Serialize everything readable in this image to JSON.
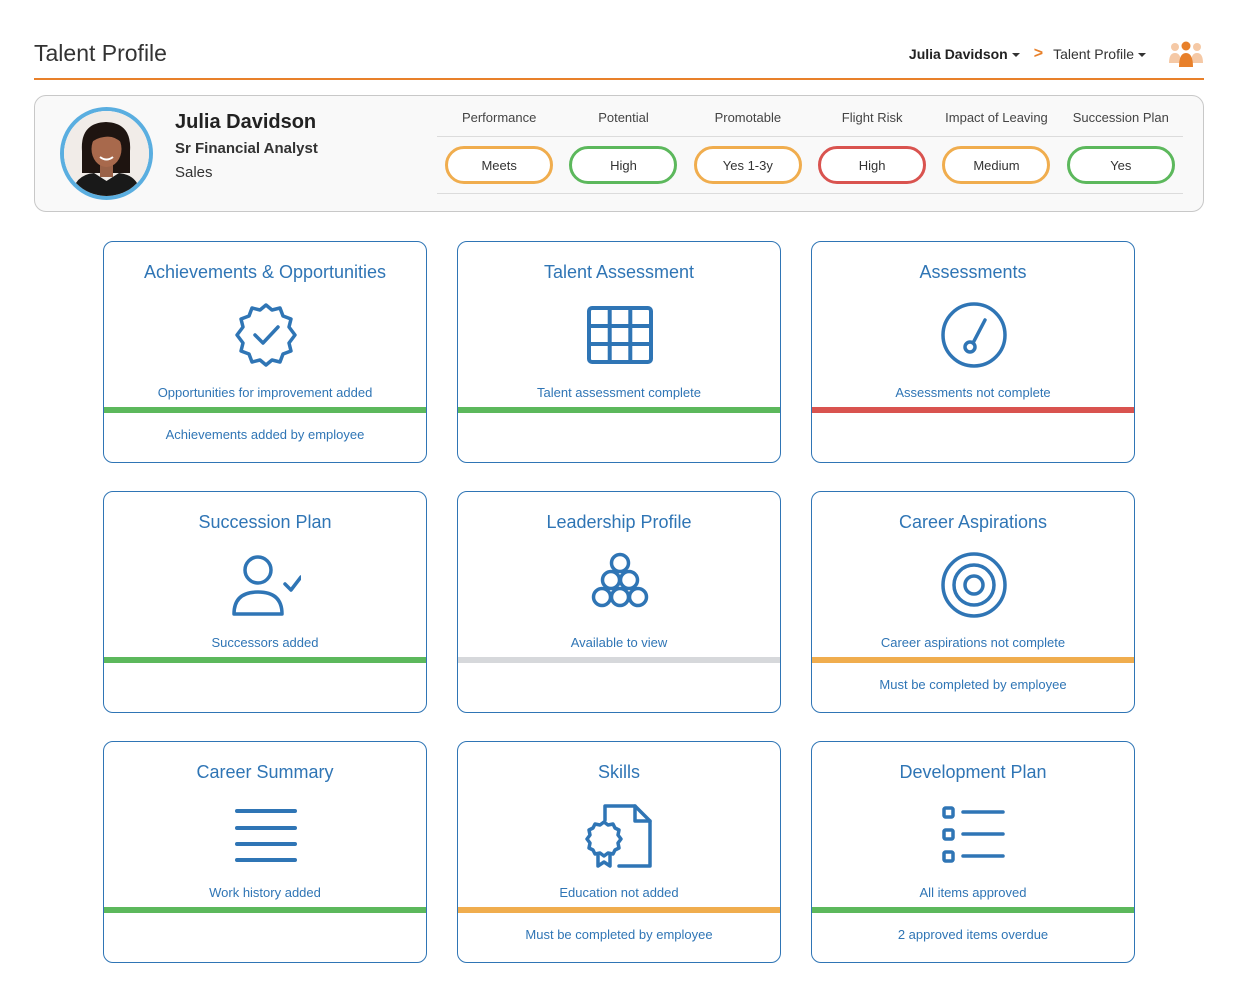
{
  "header": {
    "title": "Talent Profile",
    "user_menu": "Julia Davidson",
    "chevron": ">",
    "page_menu": "Talent Profile",
    "icon": "people-group-icon"
  },
  "profile": {
    "name": "Julia Davidson",
    "job_title": "Sr Financial Analyst",
    "department": "Sales",
    "metrics": [
      {
        "label": "Performance",
        "value": "Meets",
        "color": "#f0ad4e"
      },
      {
        "label": "Potential",
        "value": "High",
        "color": "#5cb85c"
      },
      {
        "label": "Promotable",
        "value": "Yes 1-3y",
        "color": "#f0ad4e"
      },
      {
        "label": "Flight Risk",
        "value": "High",
        "color": "#d9534f"
      },
      {
        "label": "Impact of Leaving",
        "value": "Medium",
        "color": "#f0ad4e"
      },
      {
        "label": "Succession Plan",
        "value": "Yes",
        "color": "#5cb85c"
      }
    ]
  },
  "colors": {
    "accent": "#e8802a",
    "card_blue": "#2f75b5",
    "green": "#5cb85c",
    "red": "#d9534f",
    "orange": "#f0ad4e",
    "gray": "#d6d8db"
  },
  "cards": [
    {
      "title": "Achievements & Opportunities",
      "icon": "badge-check-icon",
      "status": "Opportunities for improvement added",
      "bar_color": "#5cb85c",
      "note": "Achievements added by employee"
    },
    {
      "title": "Talent Assessment",
      "icon": "grid-icon",
      "status": "Talent assessment complete",
      "bar_color": "#5cb85c",
      "note": ""
    },
    {
      "title": "Assessments",
      "icon": "gauge-icon",
      "status": "Assessments not complete",
      "bar_color": "#d9534f",
      "note": ""
    },
    {
      "title": "Succession Plan",
      "icon": "user-check-icon",
      "status": "Successors added",
      "bar_color": "#5cb85c",
      "note": ""
    },
    {
      "title": "Leadership Profile",
      "icon": "circles-pyramid-icon",
      "status": "Available to view",
      "bar_color": "#d6d8db",
      "note": ""
    },
    {
      "title": "Career Aspirations",
      "icon": "target-icon",
      "status": "Career aspirations not complete",
      "bar_color": "#f0ad4e",
      "note": "Must be completed by employee"
    },
    {
      "title": "Career Summary",
      "icon": "lines-icon",
      "status": "Work history added",
      "bar_color": "#5cb85c",
      "note": ""
    },
    {
      "title": "Skills",
      "icon": "certificate-document-icon",
      "status": "Education not added",
      "bar_color": "#f0ad4e",
      "note": "Must be completed by employee"
    },
    {
      "title": "Development Plan",
      "icon": "checklist-icon",
      "status": "All items approved",
      "bar_color": "#5cb85c",
      "note": "2 approved items overdue"
    }
  ]
}
